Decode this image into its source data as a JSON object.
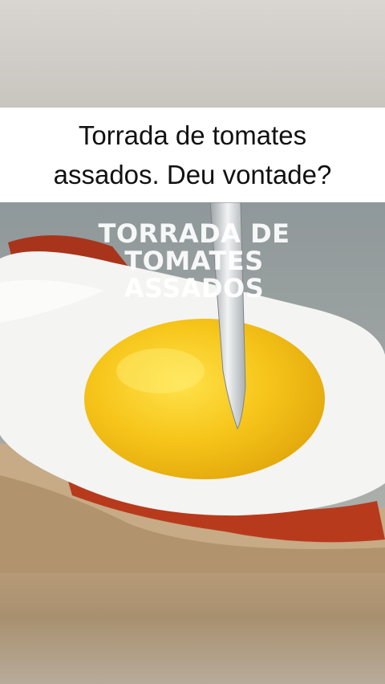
{
  "caption": {
    "line1": "Torrada de tomates",
    "line2": "assados. Deu vontade?"
  },
  "video_overlay": {
    "line1": "TORRADA DE",
    "line2": "TOMATES",
    "line3": "ASSADOS"
  },
  "photo": {
    "subject": "fried-egg-on-toast-with-roasted-tomatoes",
    "colors": {
      "yolk": "#f4c419",
      "egg_white": "#f4f4f2",
      "tomato": "#b83a1c",
      "toast": "#c6ab86",
      "background": "#9aa2a4"
    }
  }
}
